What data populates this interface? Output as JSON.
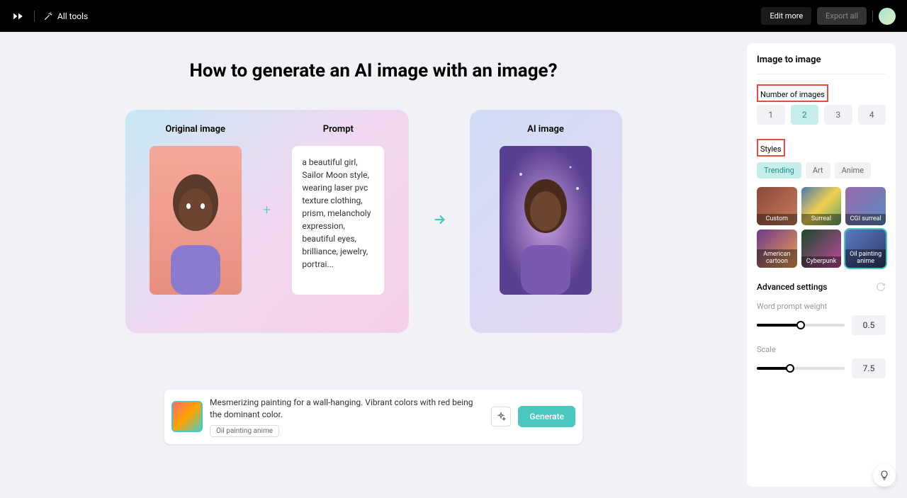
{
  "header": {
    "all_tools": "All tools",
    "edit_more": "Edit more",
    "export_all": "Export all"
  },
  "main": {
    "title": "How to generate an AI image with an image?",
    "original_label": "Original image",
    "prompt_label": "Prompt",
    "ai_label": "AI image",
    "prompt_text": "a beautiful girl, Sailor Moon style, wearing laser pvc texture clothing, prism, melancholy expression, beautiful eyes, brilliance, jewelry, portrai..."
  },
  "prompt_bar": {
    "text": "Mesmerizing painting for a wall-hanging. Vibrant colors with red being the dominant color.",
    "tag": "Oil painting anime",
    "generate": "Generate"
  },
  "sidebar": {
    "title": "Image to image",
    "num_label": "Number of images",
    "num_options": [
      "1",
      "2",
      "3",
      "4"
    ],
    "num_selected": 1,
    "styles_label": "Styles",
    "style_tabs": [
      "Trending",
      "Art",
      "Anime"
    ],
    "style_tab_selected": 0,
    "styles": [
      {
        "name": "Custom",
        "bg": "linear-gradient(135deg,#8b4a3a,#c97a5a)"
      },
      {
        "name": "Surreal",
        "bg": "linear-gradient(135deg,#4a7ab0,#f0d050,#60a060)"
      },
      {
        "name": "CGI surreal",
        "bg": "linear-gradient(135deg,#9a6aaa,#5a8ac0)"
      },
      {
        "name": "American cartoon",
        "bg": "linear-gradient(135deg,#6a3a8a,#f0a050)"
      },
      {
        "name": "Cyberpunk",
        "bg": "linear-gradient(135deg,#1a4a2a,#c04a9a)"
      },
      {
        "name": "Oil painting anime",
        "bg": "linear-gradient(135deg,#5a7ac0,#303a6a)"
      }
    ],
    "style_selected": 5,
    "advanced": "Advanced settings",
    "word_weight_label": "Word prompt weight",
    "word_weight": "0.5",
    "word_weight_pct": 50,
    "scale_label": "Scale",
    "scale": "7.5",
    "scale_pct": 38
  }
}
